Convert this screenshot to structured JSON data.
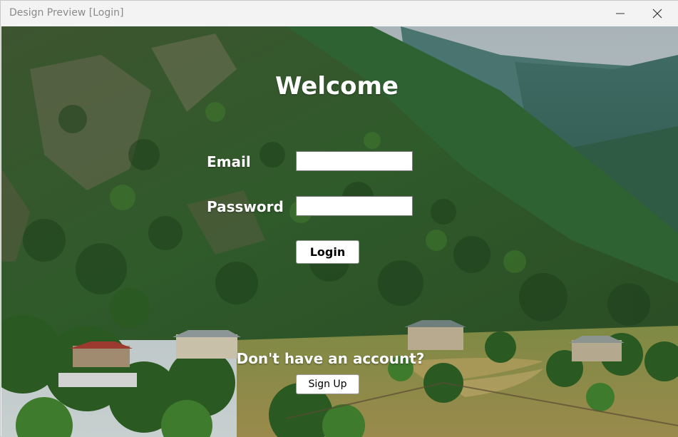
{
  "window": {
    "title": "Design Preview [Login]",
    "minimize_icon": "minimize-icon",
    "close_icon": "close-icon"
  },
  "background": {
    "description_icon": "landscape-image"
  },
  "form": {
    "heading": "Welcome",
    "email_label": "Email",
    "email_value": "",
    "password_label": "Password",
    "password_value": "",
    "login_label": "Login",
    "signup_prompt": "Don't have an account?",
    "signup_label": "Sign Up"
  },
  "colors": {
    "text": "#ffffff",
    "titlebar": "#f3f3f3"
  }
}
